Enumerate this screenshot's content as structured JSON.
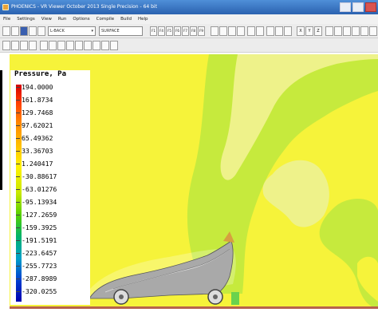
{
  "window": {
    "title": "PHOENICS - VR Viewer October 2013 Single Precision - 64 bit"
  },
  "menu": [
    "File",
    "Settings",
    "View",
    "Run",
    "Options",
    "Compile",
    "Build",
    "Help"
  ],
  "toolbar": {
    "select1": "L-BACK",
    "select2": "SURFACE",
    "function_keys": [
      "F1",
      "F4",
      "F5",
      "F6",
      "F7",
      "F8",
      "F9"
    ],
    "axis_buttons": [
      "X",
      "Y",
      "Z"
    ]
  },
  "legend": {
    "title": "Pressure, Pa",
    "values": [
      "194.0000",
      "161.8734",
      "129.7468",
      "97.62021",
      "65.49362",
      "33.36703",
      "1.240417",
      "-30.88617",
      "-63.01276",
      "-95.13934",
      "-127.2659",
      "-159.3925",
      "-191.5191",
      "-223.6457",
      "-255.7723",
      "-287.8989",
      "-320.0255"
    ]
  },
  "colors": {
    "field_yellow": "#f6f33a",
    "field_light": "#eef28a",
    "field_green": "#c6ea3d",
    "ground": "#b7624c"
  }
}
